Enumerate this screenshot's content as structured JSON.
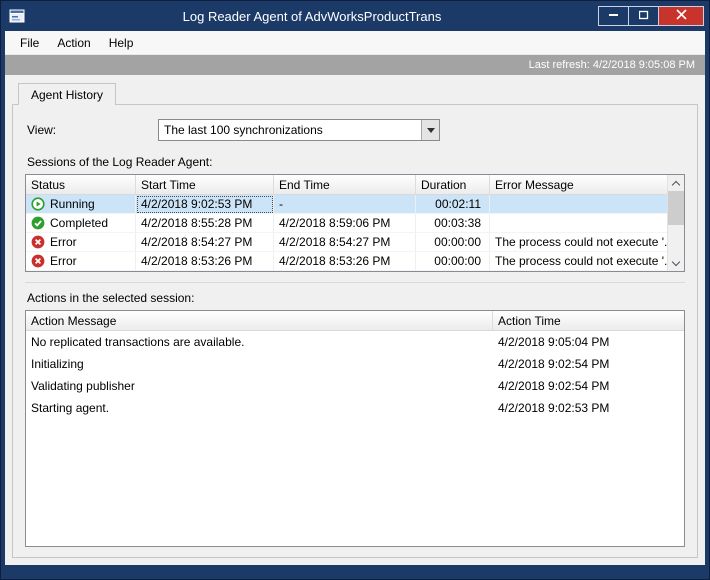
{
  "window": {
    "title": "Log Reader Agent of AdvWorksProductTrans"
  },
  "menu": {
    "items": [
      "File",
      "Action",
      "Help"
    ]
  },
  "status_bar": {
    "last_refresh": "Last refresh: 4/2/2018 9:05:08 PM"
  },
  "tabs": [
    {
      "label": "Agent History"
    }
  ],
  "view": {
    "label": "View:",
    "selected": "The last 100 synchronizations"
  },
  "sessions": {
    "label": "Sessions of the Log Reader Agent:",
    "columns": [
      "Status",
      "Start Time",
      "End Time",
      "Duration",
      "Error Message"
    ],
    "selected_row_index": 0,
    "rows": [
      {
        "icon": "running-status-icon",
        "status": "Running",
        "start": "4/2/2018 9:02:53 PM",
        "end": "-",
        "duration": "00:02:11",
        "error": ""
      },
      {
        "icon": "completed-status-icon",
        "status": "Completed",
        "start": "4/2/2018 8:55:28 PM",
        "end": "4/2/2018 8:59:06 PM",
        "duration": "00:03:38",
        "error": ""
      },
      {
        "icon": "error-status-icon",
        "status": "Error",
        "start": "4/2/2018 8:54:27 PM",
        "end": "4/2/2018 8:54:27 PM",
        "duration": "00:00:00",
        "error": "The process could not execute '..."
      },
      {
        "icon": "error-status-icon",
        "status": "Error",
        "start": "4/2/2018 8:53:26 PM",
        "end": "4/2/2018 8:53:26 PM",
        "duration": "00:00:00",
        "error": "The process could not execute '..."
      }
    ]
  },
  "actions": {
    "label": "Actions in the selected session:",
    "columns": [
      "Action Message",
      "Action Time"
    ],
    "rows": [
      {
        "message": "No replicated transactions are available.",
        "time": "4/2/2018 9:05:04 PM"
      },
      {
        "message": "Initializing",
        "time": "4/2/2018 9:02:54 PM"
      },
      {
        "message": "Validating publisher",
        "time": "4/2/2018 9:02:54 PM"
      },
      {
        "message": "Starting agent.",
        "time": "4/2/2018 9:02:53 PM"
      }
    ]
  },
  "icons": {
    "minimize": "─",
    "maximize": "□",
    "close": "✕",
    "dropdown": "▼",
    "scroll_up": "∧",
    "scroll_down": "∨",
    "running": "▶",
    "completed": "✓",
    "error": "✕"
  },
  "colors": {
    "titlebar": "#1c3a68",
    "close_button": "#c8342c",
    "status_strip": "#a3a3a3",
    "selection": "#cce4f7",
    "running_green": "#2e9e2e",
    "completed_green": "#2e9e2e",
    "error_red": "#c9302c"
  }
}
